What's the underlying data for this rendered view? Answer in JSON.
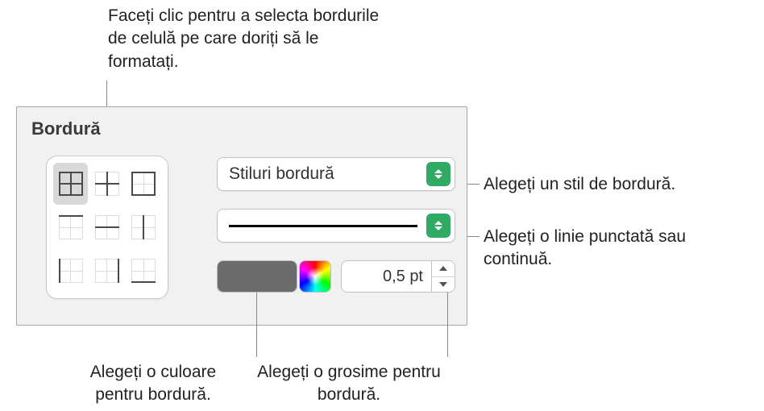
{
  "callouts": {
    "top": "Faceți clic pentru a selecta bordurile de celulă pe care doriți să le formatați.",
    "style": "Alegeți un stil de bordură.",
    "line": "Alegeți o linie punctată sau continuă.",
    "color": "Alegeți o culoare pentru bordură.",
    "thickness": "Alegeți o grosime pentru bordură."
  },
  "panel": {
    "title": "Bordură",
    "style_dropdown": "Stiluri bordură",
    "thickness_value": "0,5 pt",
    "border_color": "#6b6b6b"
  }
}
